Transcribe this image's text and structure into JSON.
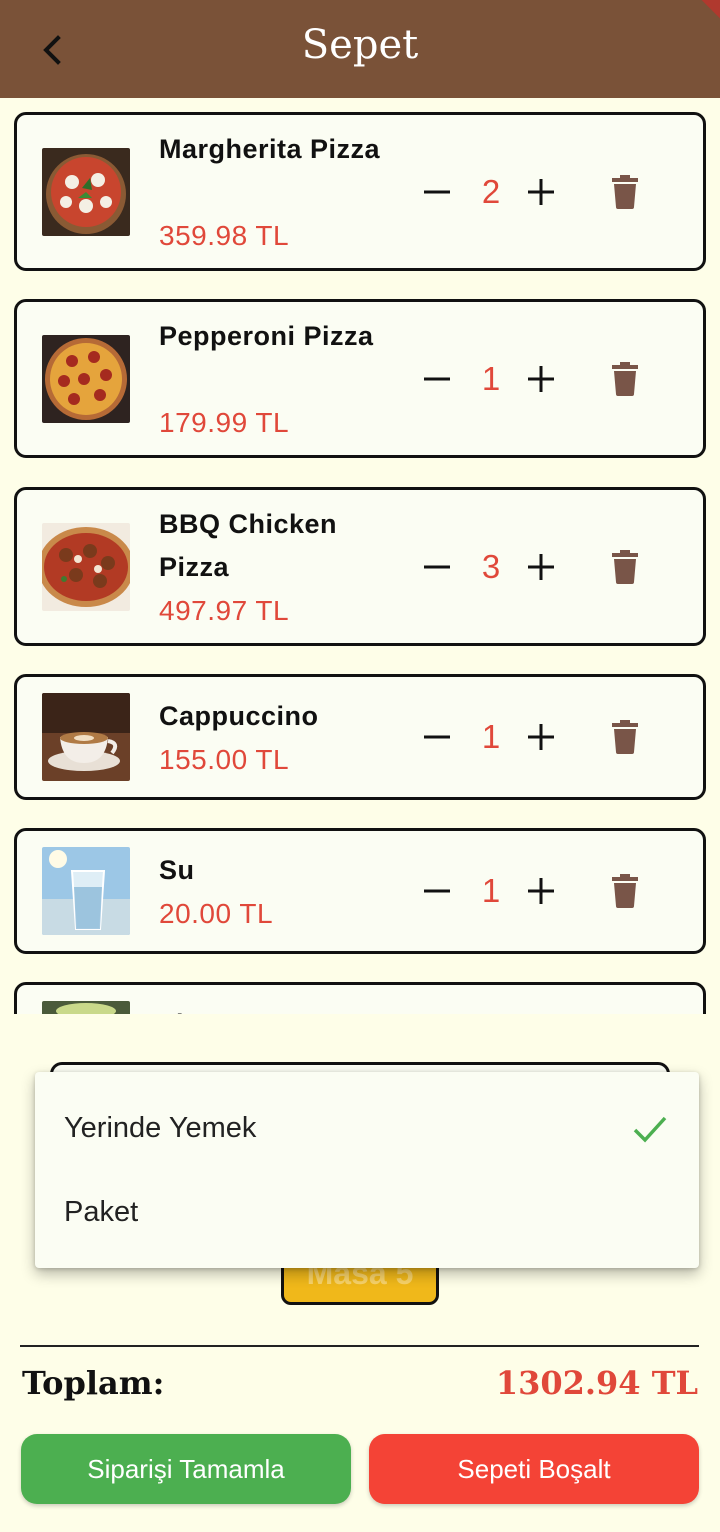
{
  "header": {
    "title": "Sepet",
    "back_icon": "arrow-back-icon"
  },
  "cart": {
    "items": [
      {
        "name": "Margherita Pizza",
        "price": "359.98 TL",
        "quantity": "2",
        "image": "margherita-pizza-photo"
      },
      {
        "name": "Pepperoni Pizza",
        "price": "179.99 TL",
        "quantity": "1",
        "image": "pepperoni-pizza-photo"
      },
      {
        "name": "BBQ Chicken Pizza",
        "price": "497.97 TL",
        "quantity": "3",
        "image": "bbq-chicken-pizza-photo"
      },
      {
        "name": "Cappuccino",
        "price": "155.00 TL",
        "quantity": "1",
        "image": "cappuccino-photo"
      },
      {
        "name": "Su",
        "price": "20.00 TL",
        "quantity": "1",
        "image": "water-glass-photo"
      },
      {
        "name": "Limonata",
        "price": "",
        "quantity": "",
        "image": "lemonade-photo"
      }
    ]
  },
  "order_type": {
    "options": [
      "Yerinde Yemek",
      "Paket"
    ],
    "selected": "Yerinde Yemek"
  },
  "table": {
    "label": "Masa 5"
  },
  "summary": {
    "total_label": "Toplam:",
    "total_value": "1302.94 TL"
  },
  "actions": {
    "complete_label": "Siparişi Tamamla",
    "clear_label": "Sepeti Boşalt"
  },
  "colors": {
    "appbar": "#7a5238",
    "price": "#e0483a",
    "complete": "#4caf50",
    "clear": "#f44336",
    "trash": "#795548",
    "check": "#4caf50"
  }
}
